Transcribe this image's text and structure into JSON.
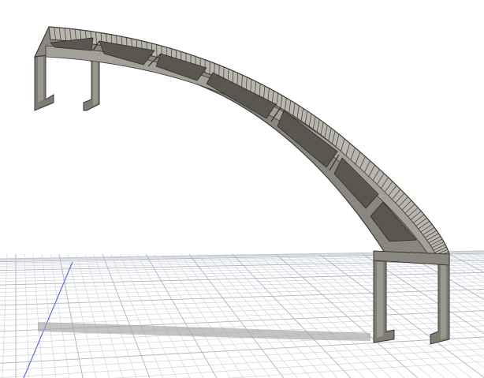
{
  "viewport": {
    "background": "#ffffff",
    "mode": "3d-model-view"
  },
  "scene": {
    "model": {
      "name": "curved-bridge-bracket",
      "body_color": "#7a776f",
      "face_light": "#b5b3aa",
      "face_mid": "#97958b",
      "edge_color": "#3a3934"
    },
    "grid": {
      "plane": "ground",
      "line_color": "#c9ced6",
      "major_line_color": "#aeb5bf",
      "axis_color": "#5b63d6"
    },
    "shadow": {
      "color": "#9e9e9e"
    }
  }
}
